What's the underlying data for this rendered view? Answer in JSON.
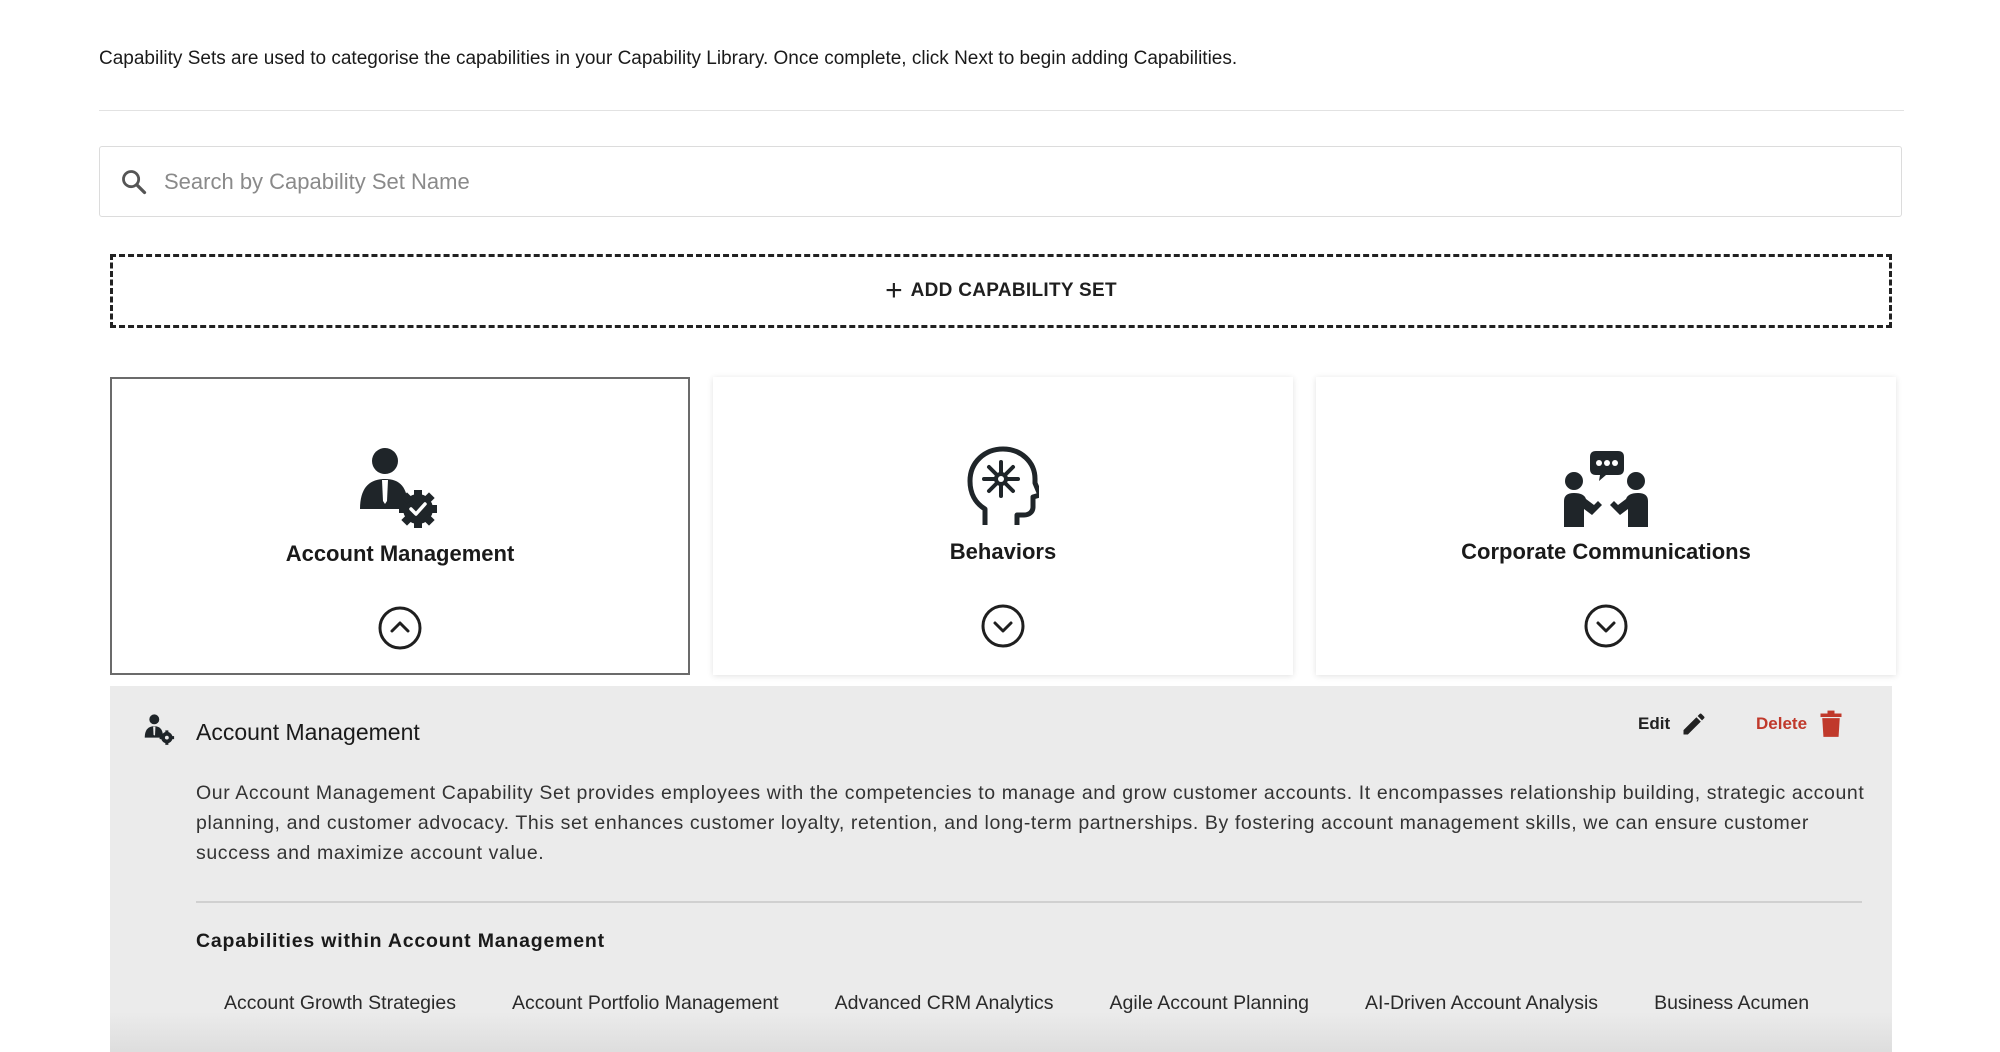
{
  "intro_text": "Capability Sets are used to categorise the capabilities in your Capability Library. Once complete, click Next to begin adding Capabilities.",
  "search": {
    "placeholder": "Search by Capability Set Name"
  },
  "add_button": {
    "label": "ADD CAPABILITY SET"
  },
  "cards": [
    {
      "title": "Account Management",
      "icon": "account-manager-gear-icon",
      "expanded": true
    },
    {
      "title": "Behaviors",
      "icon": "head-brain-icon",
      "expanded": false
    },
    {
      "title": "Corporate Communications",
      "icon": "people-conversation-icon",
      "expanded": false
    }
  ],
  "detail": {
    "title": "Account Management",
    "edit_label": "Edit",
    "delete_label": "Delete",
    "description": "Our Account Management Capability Set provides employees with the competencies to manage and grow customer accounts. It encompasses relationship building, strategic account planning, and customer advocacy. This set enhances customer loyalty, retention, and long-term partnerships. By fostering account management skills, we can ensure customer success and maximize account value.",
    "capabilities_heading": "Capabilities within Account Management",
    "capabilities": [
      "Account Growth Strategies",
      "Account Portfolio Management",
      "Advanced CRM Analytics",
      "Agile Account Planning",
      "AI-Driven Account Analysis",
      "Business Acumen"
    ]
  },
  "colors": {
    "delete": "#c0392b",
    "detail_bg": "#ebebeb",
    "icon": "#1f2529"
  }
}
